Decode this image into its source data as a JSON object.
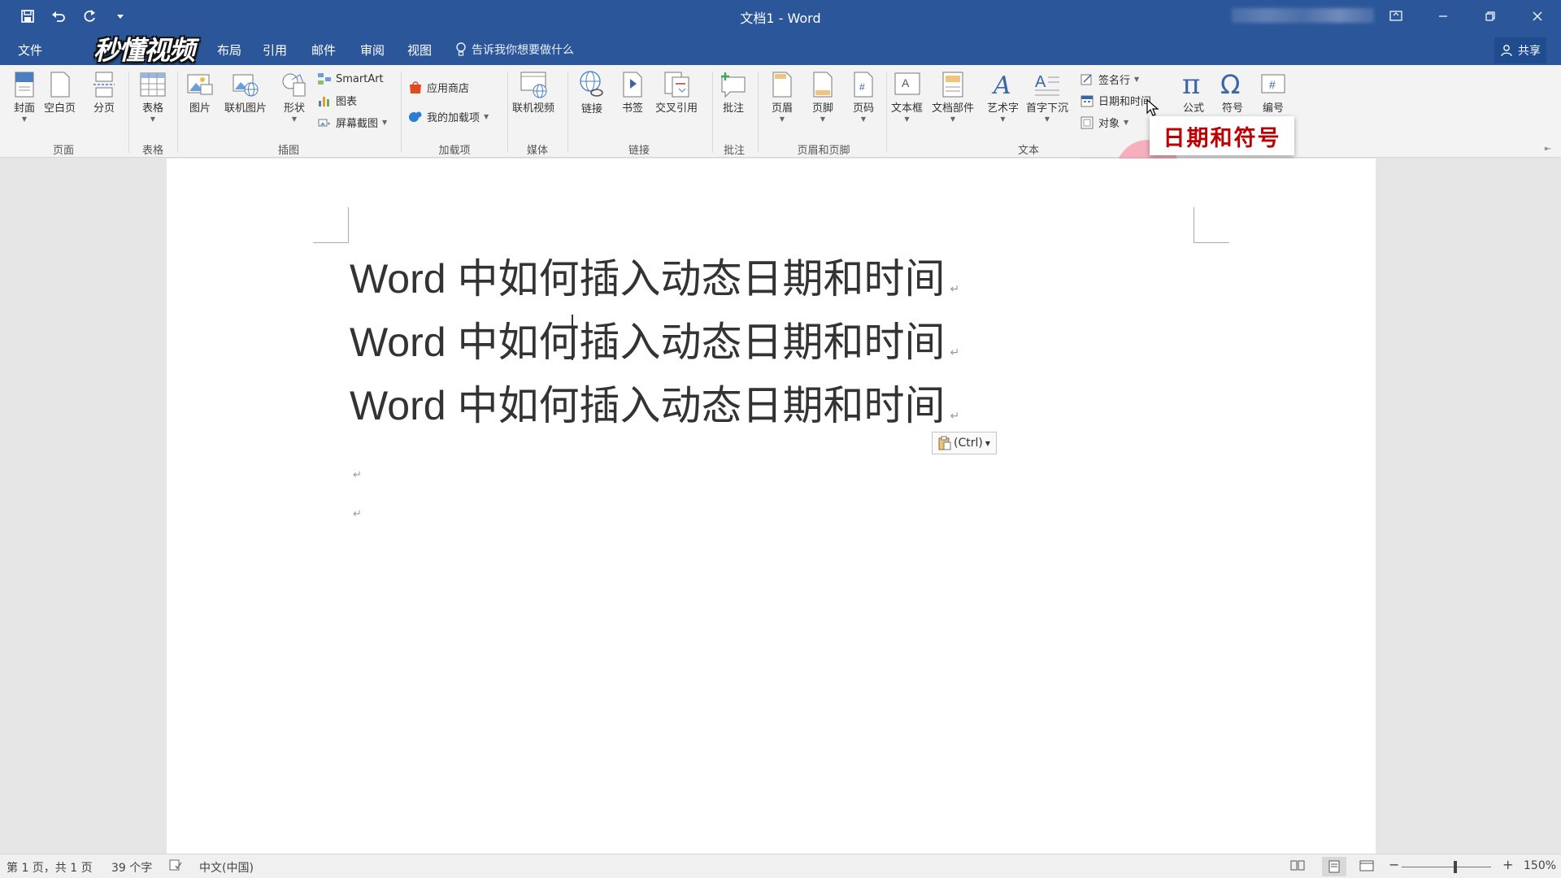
{
  "window": {
    "title": "文档1 - Word"
  },
  "menu": {
    "tabs": [
      "文件",
      "布局",
      "引用",
      "邮件",
      "审阅",
      "视图"
    ],
    "tell_me": "告诉我你想要做什么",
    "share": "共享",
    "watermark": "秒懂视频"
  },
  "ribbon": {
    "buttons": {
      "cover": "封面",
      "blank": "空白页",
      "pagebreak": "分页",
      "table": "表格",
      "picture": "图片",
      "online_picture": "联机图片",
      "shapes": "形状",
      "smartart": "SmartArt",
      "chart": "图表",
      "screenshot": "屏幕截图",
      "store": "应用商店",
      "my_addins": "我的加载项",
      "online_video": "联机视频",
      "link": "链接",
      "bookmark": "书签",
      "crossref": "交叉引用",
      "comment": "批注",
      "header": "页眉",
      "footer": "页脚",
      "pagenum": "页码",
      "textbox": "文本框",
      "quickparts": "文档部件",
      "wordart": "艺术字",
      "dropcap": "首字下沉",
      "signature": "签名行",
      "datetime": "日期和时间",
      "object": "对象",
      "equation": "公式",
      "symbol": "符号",
      "number": "编号"
    },
    "groups": {
      "pages": "页面",
      "tables": "表格",
      "illustrations": "插图",
      "addins": "加载项",
      "media": "媒体",
      "links": "链接",
      "comments": "批注",
      "headerfooter": "页眉和页脚",
      "text": "文本"
    }
  },
  "callout": "日期和符号",
  "document": {
    "lines": [
      "Word 中如何插入动态日期和时间",
      "Word 中如何插入动态日期和时间",
      "Word 中如何插入动态日期和时间"
    ],
    "paragraph_mark": "↵",
    "paste_options": "(Ctrl)"
  },
  "status": {
    "page": "第 1 页，共 1 页",
    "words": "39 个字",
    "language": "中文(中国)",
    "zoom": "150%"
  }
}
